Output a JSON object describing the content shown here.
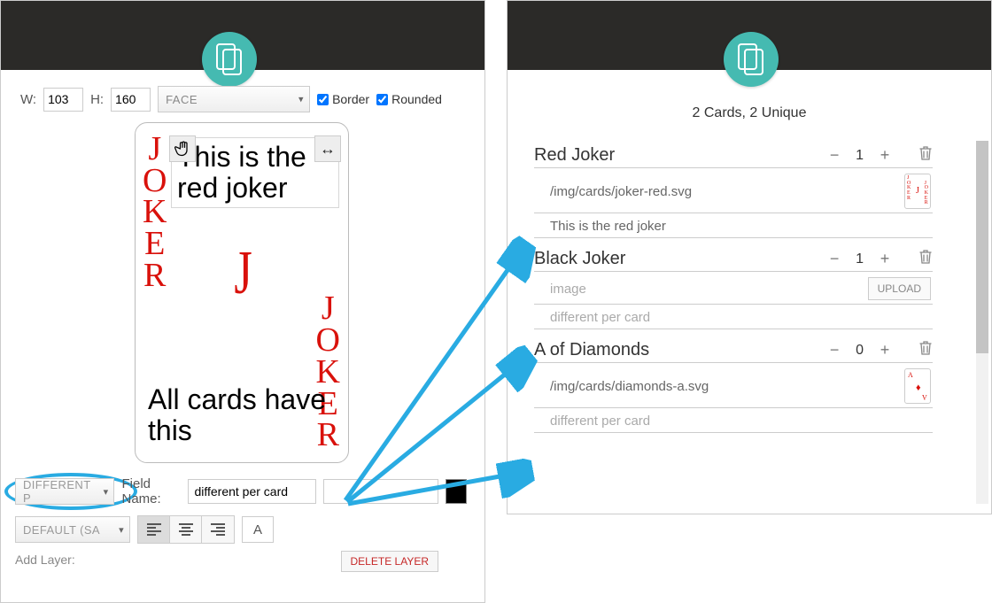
{
  "left": {
    "w_label": "W:",
    "h_label": "H:",
    "w": "103",
    "h": "160",
    "side_select": "FACE",
    "border_label": "Border",
    "rounded_label": "Rounded",
    "joker_letters": "JOKER",
    "preview_text": "This is the red joker",
    "preview_footer": "All cards have this",
    "diff_select": "DIFFERENT P",
    "field_name_label": "Field Name:",
    "field_name_value": "different per card",
    "default_select": "DEFAULT (SA",
    "addlayer": "Add Layer:",
    "delete_btn": "DELETE LAYER"
  },
  "right": {
    "summary": "2 Cards, 2 Unique",
    "upload_label": "UPLOAD",
    "cards": [
      {
        "name": "Red Joker",
        "qty": "1",
        "img": "/img/cards/joker-red.svg",
        "img_ph": false,
        "text": "This is the red joker",
        "text_ph": false,
        "thumb": "joker"
      },
      {
        "name": "Black Joker",
        "qty": "1",
        "img": "image",
        "img_ph": true,
        "text": "different per card",
        "text_ph": true,
        "thumb": "upload"
      },
      {
        "name": "A of Diamonds",
        "qty": "0",
        "img": "/img/cards/diamonds-a.svg",
        "img_ph": false,
        "text": "different per card",
        "text_ph": true,
        "thumb": "diamond"
      }
    ]
  }
}
